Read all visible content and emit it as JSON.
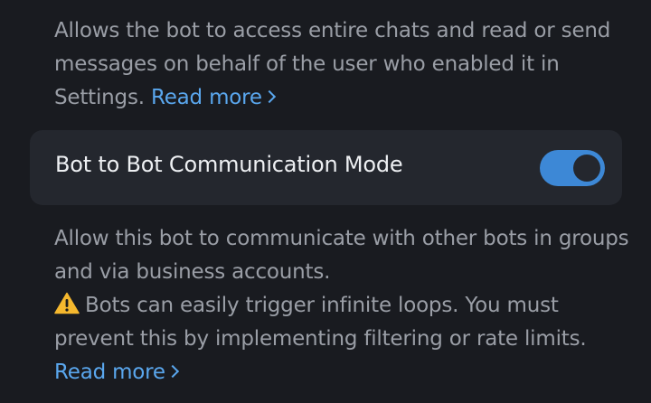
{
  "intro": {
    "text": "Allows the bot to access entire chats and read or send messages on behalf of the user who enabled it in Settings. ",
    "link": "Read more"
  },
  "setting": {
    "label": "Bot to Bot Communication Mode",
    "enabled": true,
    "accent_color": "#3d88d6"
  },
  "info": {
    "line1": "Allow this bot to communicate with other bots in groups and via business accounts.",
    "warning_icon": "warning-icon",
    "warning": "Bots can easily trigger infinite loops. You must prevent this by implementing filtering or rate limits.",
    "link": "Read more"
  }
}
